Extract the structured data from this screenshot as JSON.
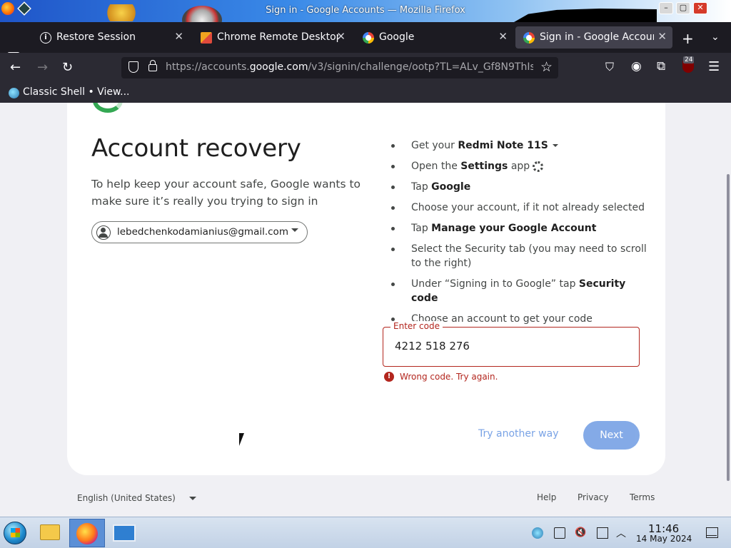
{
  "window": {
    "title": "Sign in - Google Accounts — Mozilla Firefox"
  },
  "tabs": [
    {
      "label": "Restore Session"
    },
    {
      "label": "Chrome Remote Desktop"
    },
    {
      "label": "Google"
    },
    {
      "label": "Sign in - Google Accounts"
    }
  ],
  "tab_close_glyph": "✕",
  "url": {
    "prefix": "https://accounts.",
    "domain": "google.com",
    "path": "/v3/signin/challenge/ootp?TL=ALv_Gf8N9ThIs"
  },
  "ublock_count": "24",
  "bookmarks": [
    {
      "label": "Classic Shell • View..."
    }
  ],
  "page": {
    "heading": "Account recovery",
    "subtext": "To help keep your account safe, Google wants to make sure it’s really you trying to sign in",
    "account_email": "lebedchenkodamianius@gmail.com",
    "steps": [
      {
        "pre": "Get your ",
        "bold": "Redmi Note 11S",
        "post": ""
      },
      {
        "pre": "Open the ",
        "bold": "Settings",
        "post": " app"
      },
      {
        "pre": "Tap ",
        "bold": "Google",
        "post": ""
      },
      {
        "pre": "Choose your account, if it not already selected",
        "bold": "",
        "post": ""
      },
      {
        "pre": "Tap ",
        "bold": "Manage your Google Account",
        "post": ""
      },
      {
        "pre": "Select the Security tab (you may need to scroll to the right)",
        "bold": "",
        "post": ""
      },
      {
        "pre": "Under “Signing in to Google” tap ",
        "bold": "Security code",
        "post": ""
      },
      {
        "pre": "Choose an account to get your code",
        "bold": "",
        "post": ""
      }
    ],
    "code_label": "Enter code",
    "code_value": "4212 518 276",
    "error_text": "Wrong code. Try again.",
    "try_another": "Try another way",
    "next": "Next"
  },
  "footer": {
    "language": "English (United States)",
    "help": "Help",
    "privacy": "Privacy",
    "terms": "Terms"
  },
  "taskbar": {
    "time": "11:46",
    "date": "14 May 2024"
  },
  "colors": {
    "accent": "#0b57d0",
    "error": "#b3261e",
    "tabbar": "#1c1b22",
    "navbar": "#2b2a33"
  }
}
